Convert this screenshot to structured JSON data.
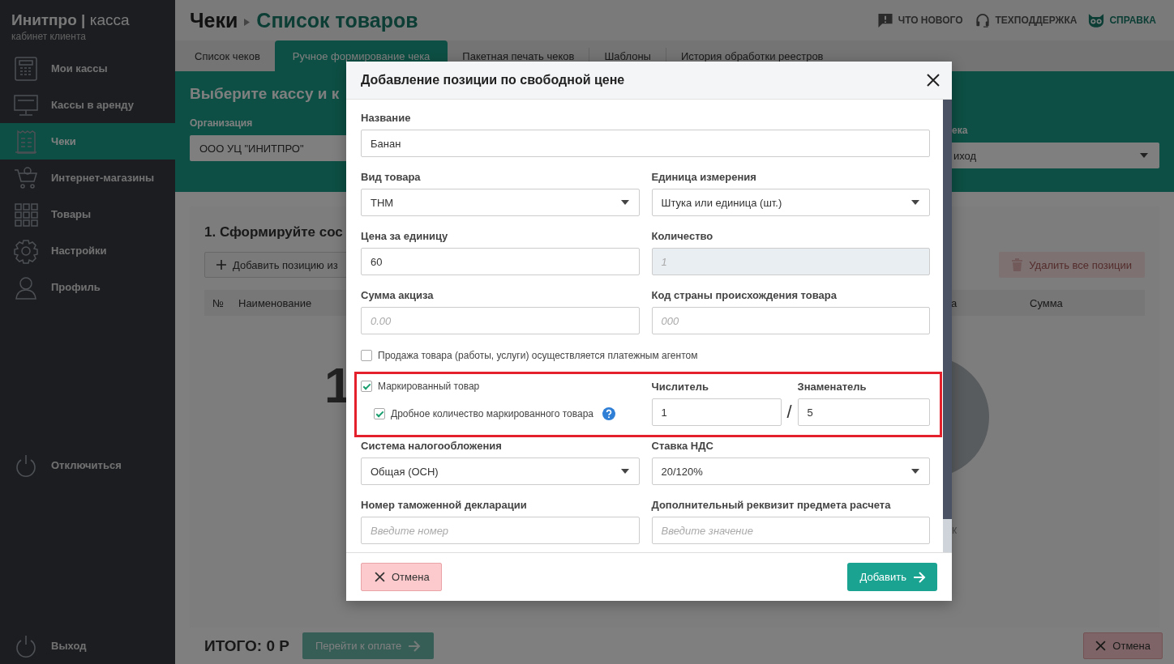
{
  "sidebar": {
    "logo": "**Инитпро |** касса",
    "subtitle": "кабинет клиента",
    "items": [
      {
        "label": "Мои кассы",
        "selected": false
      },
      {
        "label": "Кассы в аренду",
        "selected": false
      },
      {
        "label": "Чеки",
        "selected": true
      },
      {
        "label": "Интернет-магазины",
        "selected": false
      },
      {
        "label": "Товары",
        "selected": false
      },
      {
        "label": "Настройки",
        "selected": false
      },
      {
        "label": "Профиль",
        "selected": false
      }
    ],
    "disconnect": "Отключиться",
    "logout": "Выход"
  },
  "header": {
    "breadcrumb": [
      "Чеки",
      "Список товаров"
    ],
    "links": [
      {
        "label": "ЧТО НОВОГО",
        "kind": "news"
      },
      {
        "label": "ТЕХПОДДЕРЖКА",
        "kind": "support"
      },
      {
        "label": "СПРАВКА",
        "kind": "help"
      }
    ]
  },
  "tabs": [
    {
      "label": "Список чеков",
      "selected": false
    },
    {
      "label": "Ручное формирование чека",
      "selected": true
    },
    {
      "label": "Пакетная печать чеков",
      "selected": false
    },
    {
      "label": "Шаблоны",
      "selected": false
    },
    {
      "label": "История обработки реестров",
      "selected": false
    }
  ],
  "selection_panel": {
    "title": "Выберите кассу и к",
    "organization": {
      "label": "Организация",
      "value": "ООО УЦ \"ИНИТПРО\""
    },
    "receipt_type": {
      "label": "ека",
      "value": "иход"
    }
  },
  "card": {
    "title": "1. Сформируйте сос",
    "add_button": "Добавить позицию из",
    "delete_button": {
      "label": "Удалить все позиции",
      "disabled": true
    },
    "columns": [
      "№",
      "Наименование",
      "а",
      "Сумма"
    ],
    "empty_state": [
      "1",
      "к"
    ]
  },
  "footer": {
    "total": "ИТОГО: 0 Р",
    "pay_button": {
      "label": "Перейти к оплате",
      "disabled": true
    },
    "cancel_button": "Отмена"
  },
  "modal": {
    "title": "Добавление позиции по свободной цене",
    "rows": [
      {
        "fields": [
          {
            "label": "Название",
            "kind": "text",
            "value": "Банан",
            "disabled": false
          }
        ]
      },
      {
        "fields": [
          {
            "label": "Вид товара",
            "kind": "select",
            "value": "ТНМ"
          },
          {
            "label": "Единица измерения",
            "kind": "select",
            "value": "Штука или единица (шт.)"
          }
        ]
      },
      {
        "fields": [
          {
            "label": "Цена за единицу",
            "kind": "text",
            "value": "60",
            "disabled": false
          },
          {
            "label": "Количество",
            "kind": "text",
            "placeholder": "1",
            "disabled": true
          }
        ]
      },
      {
        "fields": [
          {
            "label": "Сумма акциза",
            "kind": "text",
            "placeholder": "0.00",
            "disabled": false
          },
          {
            "label": "Код страны происхождения товара",
            "kind": "text",
            "placeholder": "000",
            "disabled": false
          }
        ]
      }
    ],
    "agent": {
      "label": "Продажа товара (работы, услуги) осуществляется платежным агентом",
      "checked": false
    },
    "marked": {
      "highlighted": true,
      "main": {
        "label": "Маркированный товар",
        "checked": true
      },
      "fractional": {
        "label": "Дробное количество маркированного товара",
        "checked": true
      },
      "numerator": {
        "label": "Числитель",
        "value": "1"
      },
      "separator": "/",
      "denominator": {
        "label": "Знаменатель",
        "value": "5"
      }
    },
    "rows_after": [
      {
        "fields": [
          {
            "label": "Система налогообложения",
            "kind": "select",
            "value": "Общая (ОСН)"
          },
          {
            "label": "Ставка НДС",
            "kind": "select",
            "value": "20/120%"
          }
        ]
      },
      {
        "fields": [
          {
            "label": "Номер таможенной декларации",
            "kind": "text",
            "placeholder": "Введите номер",
            "disabled": false
          },
          {
            "label": "Дополнительный реквизит предмета расчета",
            "kind": "text",
            "placeholder": "Введите значение",
            "disabled": false
          }
        ]
      }
    ],
    "cancel_button": "Отмена",
    "add_button": "Добавить"
  }
}
